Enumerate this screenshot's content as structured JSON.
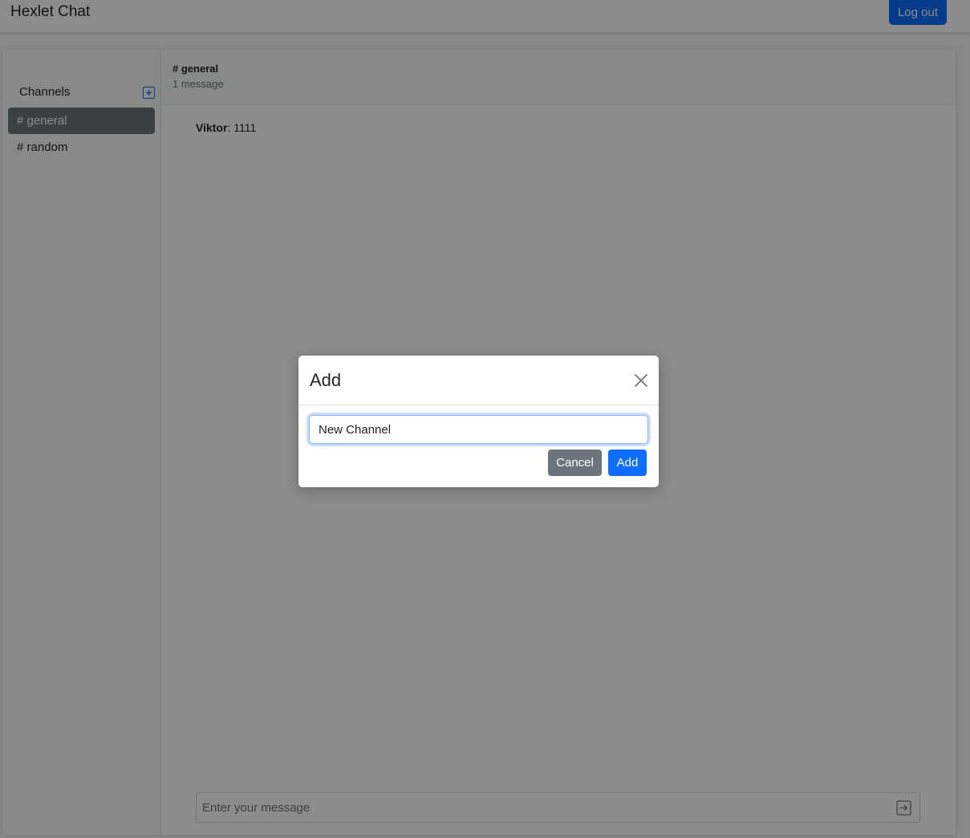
{
  "navbar": {
    "brand": "Hexlet Chat",
    "logout_label": "Log out"
  },
  "sidebar": {
    "header": "Channels",
    "add_icon": "plus-square-icon",
    "channels": [
      {
        "label": "# general",
        "active": true
      },
      {
        "label": "# random",
        "active": false
      }
    ]
  },
  "chat": {
    "title": "# general",
    "message_count": "1 message",
    "messages": [
      {
        "author": "Viktor",
        "separator": ": ",
        "text": "1111"
      }
    ],
    "input_placeholder": "Enter your message",
    "send_icon": "arrow-right-square-icon"
  },
  "modal": {
    "title": "Add",
    "close_icon": "close-icon",
    "input_value": "New Channel",
    "cancel_label": "Cancel",
    "submit_label": "Add"
  },
  "colors": {
    "primary": "#0d6efd",
    "secondary": "#6c757d"
  }
}
